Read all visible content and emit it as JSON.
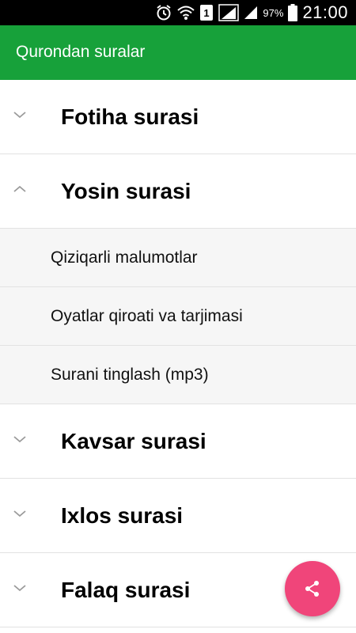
{
  "status_bar": {
    "battery_percent": "97%",
    "time": "21:00",
    "sim_label": "1",
    "icons": [
      "alarm-icon",
      "wifi-icon",
      "sim-icon",
      "signal-icon",
      "signal-icon",
      "battery-icon"
    ]
  },
  "app_bar": {
    "title": "Qurondan suralar",
    "color": "#17a13a"
  },
  "groups": [
    {
      "title": "Fotiha surasi",
      "expanded": false
    },
    {
      "title": "Yosin surasi",
      "expanded": true,
      "children": [
        "Qiziqarli malumotlar",
        "Oyatlar qiroati va tarjimasi",
        "Surani tinglash (mp3)"
      ]
    },
    {
      "title": "Kavsar surasi",
      "expanded": false
    },
    {
      "title": "Ixlos surasi",
      "expanded": false
    },
    {
      "title": "Falaq surasi",
      "expanded": false
    }
  ],
  "fab": {
    "icon": "share-icon",
    "color": "#f0457a"
  }
}
